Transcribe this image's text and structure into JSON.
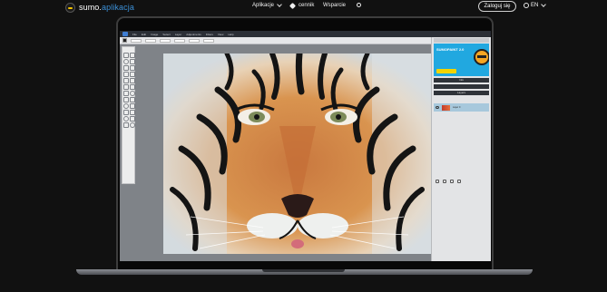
{
  "brand": {
    "name_prefix": "sumo.",
    "name_suffix": "aplikacja",
    "accent": "#3b8fd6"
  },
  "nav": {
    "apps": "Aplikacje",
    "pricing": "cennik",
    "support": "Wsparcie",
    "theme_icon": "theme-toggle-icon"
  },
  "auth": {
    "login": "Zaloguj się"
  },
  "language": {
    "current": "EN",
    "icon": "globe-icon"
  },
  "editor": {
    "menubar": [
      "File",
      "Edit",
      "Image",
      "Select",
      "Layer",
      "Adjustments",
      "Filters",
      "View",
      "Help"
    ],
    "panel": {
      "ad_title": "SUMOPAINT 2.0",
      "history": "Info",
      "layers": "Layers",
      "layer_name": "Layer 0"
    }
  },
  "colors": {
    "page_bg": "#111111",
    "screen_bg": "#7f8388",
    "panel_ad": "#21a8e0"
  }
}
